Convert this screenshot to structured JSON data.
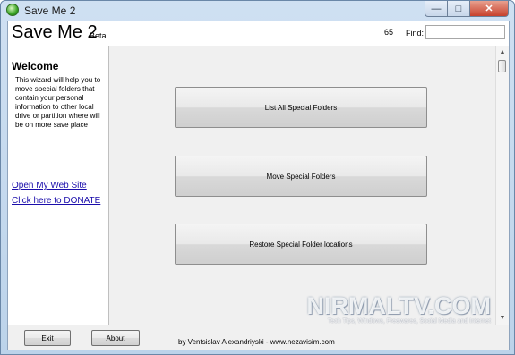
{
  "window": {
    "title": "Save Me 2"
  },
  "header": {
    "app_name": "Save Me 2",
    "badge": "Beta",
    "count": "65",
    "find_label": "Find:",
    "find_value": ""
  },
  "sidebar": {
    "heading": "Welcome",
    "description": "This wizard will help you to move special folders that contain your personal information to other local drive or partition where will be on more save place",
    "links": {
      "website": "Open My Web Site",
      "donate": "Click here to DONATE"
    }
  },
  "main": {
    "buttons": {
      "list": "List All Special Folders",
      "move": "Move Special Folders",
      "restore": "Restore Special Folder locations"
    }
  },
  "footer": {
    "exit": "Exit",
    "about": "About",
    "credit": "by Ventsislav Alexandriyski - www.nezavisim.com"
  },
  "watermark": {
    "title": "NIRMALTV.COM",
    "tagline": "Tech Tips, Windows, Freewares, Social Media and Internet"
  }
}
